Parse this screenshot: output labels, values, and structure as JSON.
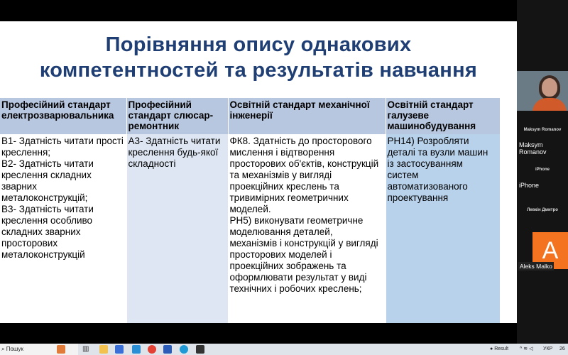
{
  "slide": {
    "title_line1": "Порівняння опису однакових",
    "title_line2": "компетентностей та результатів навчання",
    "headers": [
      "Професійний стандарт електрозварювальника",
      "Професійний стандарт слюсар-ремонтник",
      "Освітній стандарт механічної інженерії",
      "Освітній стандарт галузеве машинобудування"
    ],
    "col1_lines": [
      "В1- Здатність читати прості",
      "креслення;",
      "В2- Здатність читати",
      "креслення складних",
      "зварних",
      "металоконструкцій;",
      "В3- Здатність читати",
      "креслення особливо",
      "складних зварних",
      "просторових",
      "металоконструкцій"
    ],
    "col2_lines": [
      "А3- Здатність читати",
      "креслення будь-якої",
      "складності"
    ],
    "col3_lines": [
      "ФК8. Здатність до просторового",
      "мислення і відтворення",
      "просторових об'єктів, конструкцій",
      "та механізмів у вигляді",
      "проекційних креслень та",
      "тривимірних геометричних",
      "моделей.",
      "РН5) виконувати геометричне",
      "моделювання деталей,",
      "механізмів і конструкцій у вигляді",
      "просторових моделей і",
      "проекційних зображень та",
      "оформлювати результат у виді",
      "технічних і робочих креслень;"
    ],
    "col4_lines": [
      "РН14) Розробляти",
      "деталі та вузли машин",
      "із застосуванням",
      "систем",
      "автоматизованого",
      "проектування"
    ]
  },
  "participants": {
    "p1_small": "Maksym Romanov",
    "p1": "Maksym Romanov",
    "p2_small": "iPhone",
    "p2": "iPhone",
    "p3_small": "Левкін Дмитро",
    "avatar_letter": "A",
    "p4": "Aleks Malko"
  },
  "taskbar": {
    "search": "Пошук",
    "result": "Result",
    "lang": "УКР",
    "clock": "26"
  },
  "colors": {
    "title": "#1f3f74",
    "header_bg": "#b8c7e0",
    "avatar": "#f47321"
  }
}
